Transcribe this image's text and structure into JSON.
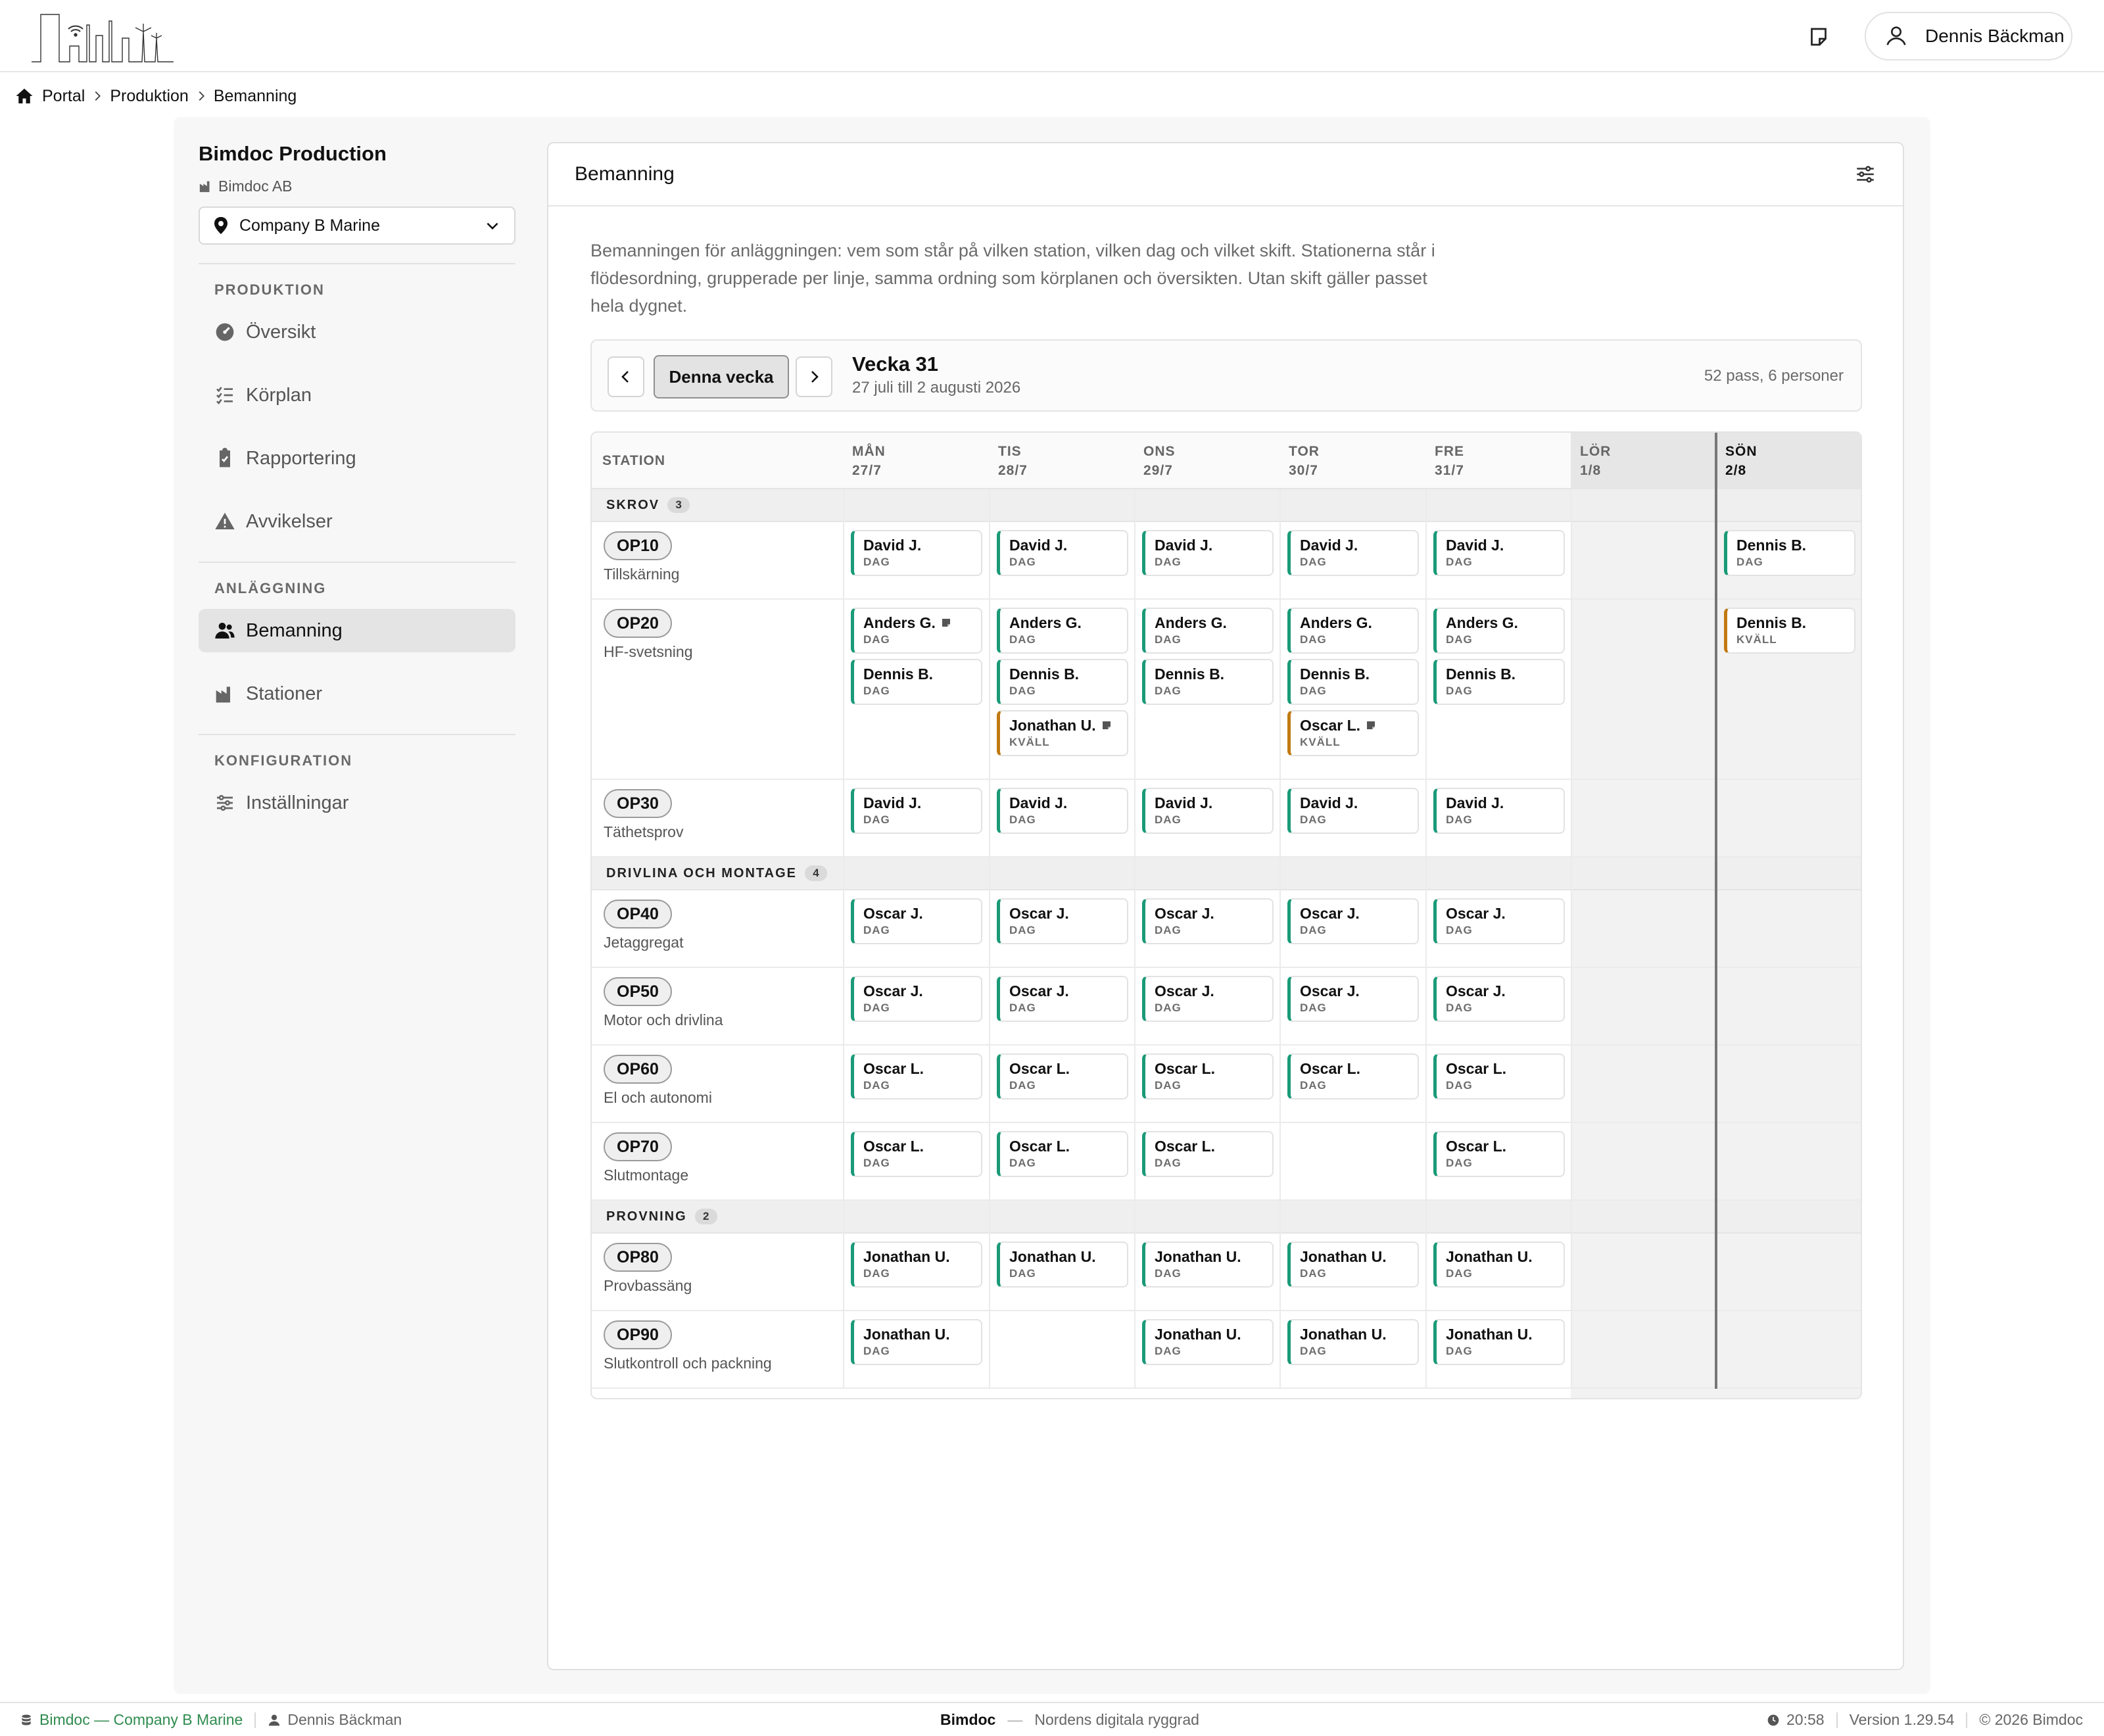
{
  "topbar": {
    "user_name": "Dennis Bäckman"
  },
  "breadcrumb": [
    "Portal",
    "Produktion",
    "Bemanning"
  ],
  "sidebar": {
    "site_title": "Bimdoc Production",
    "site_sub": "Bimdoc AB",
    "company": "Company B Marine",
    "sections": {
      "produktion": "PRODUKTION",
      "anlaggning": "ANLÄGGNING",
      "konfiguration": "KONFIGURATION"
    },
    "items": {
      "oversikt": "Översikt",
      "korplan": "Körplan",
      "rapportering": "Rapportering",
      "avvikelser": "Avvikelser",
      "bemanning": "Bemanning",
      "stationer": "Stationer",
      "installningar": "Inställningar"
    },
    "active": "Bemanning"
  },
  "main": {
    "title": "Bemanning",
    "intro": "Bemanningen för anläggningen: vem som står på vilken station, vilken dag och vilket skift. Stationerna står i flödesordning, grupperade per linje, samma ordning som körplanen och översikten. Utan skift gäller passet hela dygnet.",
    "week": {
      "today_label": "Denna vecka",
      "title": "Vecka 31",
      "range": "27 juli till 2 augusti 2026",
      "summary": "52 pass, 6 personer"
    }
  },
  "schedule": {
    "station_header": "STATION",
    "days": [
      {
        "name": "MÅN",
        "date": "27/7"
      },
      {
        "name": "TIS",
        "date": "28/7"
      },
      {
        "name": "ONS",
        "date": "29/7"
      },
      {
        "name": "TOR",
        "date": "30/7"
      },
      {
        "name": "FRE",
        "date": "31/7"
      },
      {
        "name": "LÖR",
        "date": "1/8"
      },
      {
        "name": "SÖN",
        "date": "2/8"
      }
    ],
    "groups": [
      {
        "name": "SKROV",
        "count": "3",
        "stations": [
          {
            "code": "OP10",
            "name": "Tillskärning",
            "shifts": [
              [
                {
                  "person": "David J.",
                  "shift": "DAG"
                }
              ],
              [
                {
                  "person": "David J.",
                  "shift": "DAG"
                }
              ],
              [
                {
                  "person": "David J.",
                  "shift": "DAG"
                }
              ],
              [
                {
                  "person": "David J.",
                  "shift": "DAG"
                }
              ],
              [
                {
                  "person": "David J.",
                  "shift": "DAG"
                }
              ],
              [],
              [
                {
                  "person": "Dennis B.",
                  "shift": "DAG"
                }
              ]
            ]
          },
          {
            "code": "OP20",
            "name": "HF-svetsning",
            "shifts": [
              [
                {
                  "person": "Anders G.",
                  "shift": "DAG",
                  "note": true
                },
                {
                  "person": "Dennis B.",
                  "shift": "DAG"
                }
              ],
              [
                {
                  "person": "Anders G.",
                  "shift": "DAG"
                },
                {
                  "person": "Dennis B.",
                  "shift": "DAG"
                },
                {
                  "person": "Jonathan U.",
                  "shift": "KVÄLL",
                  "note": true
                }
              ],
              [
                {
                  "person": "Anders G.",
                  "shift": "DAG"
                },
                {
                  "person": "Dennis B.",
                  "shift": "DAG"
                }
              ],
              [
                {
                  "person": "Anders G.",
                  "shift": "DAG"
                },
                {
                  "person": "Dennis B.",
                  "shift": "DAG"
                },
                {
                  "person": "Oscar L.",
                  "shift": "KVÄLL",
                  "note": true
                }
              ],
              [
                {
                  "person": "Anders G.",
                  "shift": "DAG"
                },
                {
                  "person": "Dennis B.",
                  "shift": "DAG"
                }
              ],
              [],
              [
                {
                  "person": "Dennis B.",
                  "shift": "KVÄLL"
                }
              ]
            ]
          },
          {
            "code": "OP30",
            "name": "Täthetsprov",
            "shifts": [
              [
                {
                  "person": "David J.",
                  "shift": "DAG"
                }
              ],
              [
                {
                  "person": "David J.",
                  "shift": "DAG"
                }
              ],
              [
                {
                  "person": "David J.",
                  "shift": "DAG"
                }
              ],
              [
                {
                  "person": "David J.",
                  "shift": "DAG"
                }
              ],
              [
                {
                  "person": "David J.",
                  "shift": "DAG"
                }
              ],
              [],
              []
            ]
          }
        ]
      },
      {
        "name": "DRIVLINA OCH MONTAGE",
        "count": "4",
        "stations": [
          {
            "code": "OP40",
            "name": "Jetaggregat",
            "shifts": [
              [
                {
                  "person": "Oscar J.",
                  "shift": "DAG"
                }
              ],
              [
                {
                  "person": "Oscar J.",
                  "shift": "DAG"
                }
              ],
              [
                {
                  "person": "Oscar J.",
                  "shift": "DAG"
                }
              ],
              [
                {
                  "person": "Oscar J.",
                  "shift": "DAG"
                }
              ],
              [
                {
                  "person": "Oscar J.",
                  "shift": "DAG"
                }
              ],
              [],
              []
            ]
          },
          {
            "code": "OP50",
            "name": "Motor och drivlina",
            "shifts": [
              [
                {
                  "person": "Oscar J.",
                  "shift": "DAG"
                }
              ],
              [
                {
                  "person": "Oscar J.",
                  "shift": "DAG"
                }
              ],
              [
                {
                  "person": "Oscar J.",
                  "shift": "DAG"
                }
              ],
              [
                {
                  "person": "Oscar J.",
                  "shift": "DAG"
                }
              ],
              [
                {
                  "person": "Oscar J.",
                  "shift": "DAG"
                }
              ],
              [],
              []
            ]
          },
          {
            "code": "OP60",
            "name": "El och autonomi",
            "shifts": [
              [
                {
                  "person": "Oscar L.",
                  "shift": "DAG"
                }
              ],
              [
                {
                  "person": "Oscar L.",
                  "shift": "DAG"
                }
              ],
              [
                {
                  "person": "Oscar L.",
                  "shift": "DAG"
                }
              ],
              [
                {
                  "person": "Oscar L.",
                  "shift": "DAG"
                }
              ],
              [
                {
                  "person": "Oscar L.",
                  "shift": "DAG"
                }
              ],
              [],
              []
            ]
          },
          {
            "code": "OP70",
            "name": "Slutmontage",
            "shifts": [
              [
                {
                  "person": "Oscar L.",
                  "shift": "DAG"
                }
              ],
              [
                {
                  "person": "Oscar L.",
                  "shift": "DAG"
                }
              ],
              [
                {
                  "person": "Oscar L.",
                  "shift": "DAG"
                }
              ],
              [],
              [
                {
                  "person": "Oscar L.",
                  "shift": "DAG"
                }
              ],
              [],
              []
            ]
          }
        ]
      },
      {
        "name": "PROVNING",
        "count": "2",
        "stations": [
          {
            "code": "OP80",
            "name": "Provbassäng",
            "shifts": [
              [
                {
                  "person": "Jonathan U.",
                  "shift": "DAG"
                }
              ],
              [
                {
                  "person": "Jonathan U.",
                  "shift": "DAG"
                }
              ],
              [
                {
                  "person": "Jonathan U.",
                  "shift": "DAG"
                }
              ],
              [
                {
                  "person": "Jonathan U.",
                  "shift": "DAG"
                }
              ],
              [
                {
                  "person": "Jonathan U.",
                  "shift": "DAG"
                }
              ],
              [],
              []
            ]
          },
          {
            "code": "OP90",
            "name": "Slutkontroll och packning",
            "shifts": [
              [
                {
                  "person": "Jonathan U.",
                  "shift": "DAG"
                }
              ],
              [],
              [
                {
                  "person": "Jonathan U.",
                  "shift": "DAG"
                }
              ],
              [
                {
                  "person": "Jonathan U.",
                  "shift": "DAG"
                }
              ],
              [
                {
                  "person": "Jonathan U.",
                  "shift": "DAG"
                }
              ],
              [],
              []
            ]
          }
        ]
      }
    ]
  },
  "footer": {
    "app": "Bimdoc — Company B Marine",
    "user": "Dennis Bäckman",
    "brand": "Bimdoc",
    "dash": "—",
    "tagline": "Nordens digitala ryggrad",
    "time": "20:58",
    "version": "Version 1.29.54",
    "copyright": "© 2026 Bimdoc"
  },
  "colors": {
    "day_shift": "#1a9a78",
    "evening_shift": "#c17a12",
    "footer_app": "#2e8b4e"
  }
}
